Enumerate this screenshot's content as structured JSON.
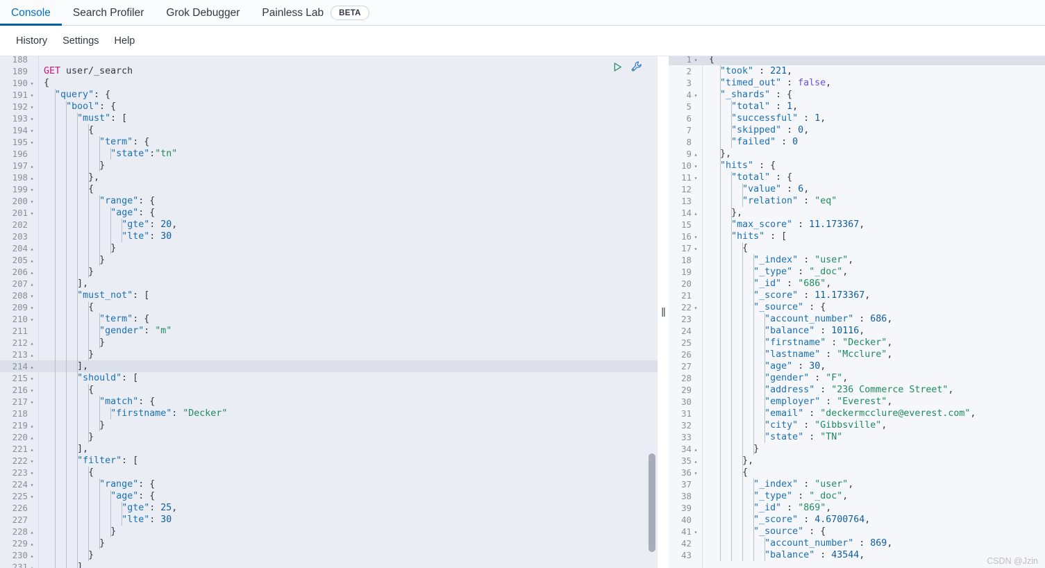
{
  "tabs": [
    {
      "label": "Console",
      "active": true,
      "badge": null
    },
    {
      "label": "Search Profiler",
      "active": false,
      "badge": null
    },
    {
      "label": "Grok Debugger",
      "active": false,
      "badge": null
    },
    {
      "label": "Painless Lab",
      "active": false,
      "badge": "BETA"
    }
  ],
  "subnav": [
    {
      "label": "History"
    },
    {
      "label": "Settings"
    },
    {
      "label": "Help"
    }
  ],
  "editor": {
    "actions": [
      {
        "name": "send-request-play-icon",
        "title": "Click to send request"
      },
      {
        "name": "wrench-icon",
        "title": "Open documentation"
      }
    ],
    "active_line": 214,
    "first_visible_line": 188,
    "lines": [
      {
        "n": 188,
        "fold": "",
        "text": "",
        "clipped": "top"
      },
      {
        "n": 189,
        "fold": "",
        "text": "GET user/_search"
      },
      {
        "n": 190,
        "fold": "v",
        "text": "{"
      },
      {
        "n": 191,
        "fold": "v",
        "text": "  \"query\": {"
      },
      {
        "n": 192,
        "fold": "v",
        "text": "    \"bool\": {"
      },
      {
        "n": 193,
        "fold": "v",
        "text": "      \"must\": ["
      },
      {
        "n": 194,
        "fold": "v",
        "text": "        {"
      },
      {
        "n": 195,
        "fold": "v",
        "text": "          \"term\": {"
      },
      {
        "n": 196,
        "fold": "",
        "text": "            \"state\":\"tn\""
      },
      {
        "n": 197,
        "fold": "^",
        "text": "          }"
      },
      {
        "n": 198,
        "fold": "^",
        "text": "        },"
      },
      {
        "n": 199,
        "fold": "v",
        "text": "        {"
      },
      {
        "n": 200,
        "fold": "v",
        "text": "          \"range\": {"
      },
      {
        "n": 201,
        "fold": "v",
        "text": "            \"age\": {"
      },
      {
        "n": 202,
        "fold": "",
        "text": "              \"gte\": 20,"
      },
      {
        "n": 203,
        "fold": "",
        "text": "              \"lte\": 30"
      },
      {
        "n": 204,
        "fold": "^",
        "text": "            }"
      },
      {
        "n": 205,
        "fold": "^",
        "text": "          }"
      },
      {
        "n": 206,
        "fold": "^",
        "text": "        }"
      },
      {
        "n": 207,
        "fold": "^",
        "text": "      ],"
      },
      {
        "n": 208,
        "fold": "v",
        "text": "      \"must_not\": ["
      },
      {
        "n": 209,
        "fold": "v",
        "text": "        {"
      },
      {
        "n": 210,
        "fold": "v",
        "text": "          \"term\": {"
      },
      {
        "n": 211,
        "fold": "",
        "text": "          \"gender\": \"m\""
      },
      {
        "n": 212,
        "fold": "^",
        "text": "          }"
      },
      {
        "n": 213,
        "fold": "^",
        "text": "        }"
      },
      {
        "n": 214,
        "fold": "^",
        "text": "      ],"
      },
      {
        "n": 215,
        "fold": "v",
        "text": "      \"should\": ["
      },
      {
        "n": 216,
        "fold": "v",
        "text": "        {"
      },
      {
        "n": 217,
        "fold": "v",
        "text": "          \"match\": {"
      },
      {
        "n": 218,
        "fold": "",
        "text": "            \"firstname\": \"Decker\""
      },
      {
        "n": 219,
        "fold": "^",
        "text": "          }"
      },
      {
        "n": 220,
        "fold": "^",
        "text": "        }"
      },
      {
        "n": 221,
        "fold": "^",
        "text": "      ],"
      },
      {
        "n": 222,
        "fold": "v",
        "text": "      \"filter\": ["
      },
      {
        "n": 223,
        "fold": "v",
        "text": "        {"
      },
      {
        "n": 224,
        "fold": "v",
        "text": "          \"range\": {"
      },
      {
        "n": 225,
        "fold": "v",
        "text": "            \"age\": {"
      },
      {
        "n": 226,
        "fold": "",
        "text": "              \"gte\": 25,"
      },
      {
        "n": 227,
        "fold": "",
        "text": "              \"lte\": 30"
      },
      {
        "n": 228,
        "fold": "^",
        "text": "            }"
      },
      {
        "n": 229,
        "fold": "^",
        "text": "          }"
      },
      {
        "n": 230,
        "fold": "^",
        "text": "        }"
      },
      {
        "n": 231,
        "fold": "^",
        "text": "      ]",
        "clipped": "bottom"
      }
    ]
  },
  "output": {
    "active_line": 1,
    "lines": [
      {
        "n": 1,
        "fold": "v",
        "text": "{"
      },
      {
        "n": 2,
        "fold": "",
        "text": "  \"took\" : 221,"
      },
      {
        "n": 3,
        "fold": "",
        "text": "  \"timed_out\" : false,"
      },
      {
        "n": 4,
        "fold": "v",
        "text": "  \"_shards\" : {"
      },
      {
        "n": 5,
        "fold": "",
        "text": "    \"total\" : 1,"
      },
      {
        "n": 6,
        "fold": "",
        "text": "    \"successful\" : 1,"
      },
      {
        "n": 7,
        "fold": "",
        "text": "    \"skipped\" : 0,"
      },
      {
        "n": 8,
        "fold": "",
        "text": "    \"failed\" : 0"
      },
      {
        "n": 9,
        "fold": "^",
        "text": "  },"
      },
      {
        "n": 10,
        "fold": "v",
        "text": "  \"hits\" : {"
      },
      {
        "n": 11,
        "fold": "v",
        "text": "    \"total\" : {"
      },
      {
        "n": 12,
        "fold": "",
        "text": "      \"value\" : 6,"
      },
      {
        "n": 13,
        "fold": "",
        "text": "      \"relation\" : \"eq\""
      },
      {
        "n": 14,
        "fold": "^",
        "text": "    },"
      },
      {
        "n": 15,
        "fold": "",
        "text": "    \"max_score\" : 11.173367,"
      },
      {
        "n": 16,
        "fold": "v",
        "text": "    \"hits\" : ["
      },
      {
        "n": 17,
        "fold": "v",
        "text": "      {"
      },
      {
        "n": 18,
        "fold": "",
        "text": "        \"_index\" : \"user\","
      },
      {
        "n": 19,
        "fold": "",
        "text": "        \"_type\" : \"_doc\","
      },
      {
        "n": 20,
        "fold": "",
        "text": "        \"_id\" : \"686\","
      },
      {
        "n": 21,
        "fold": "",
        "text": "        \"_score\" : 11.173367,"
      },
      {
        "n": 22,
        "fold": "v",
        "text": "        \"_source\" : {"
      },
      {
        "n": 23,
        "fold": "",
        "text": "          \"account_number\" : 686,"
      },
      {
        "n": 24,
        "fold": "",
        "text": "          \"balance\" : 10116,"
      },
      {
        "n": 25,
        "fold": "",
        "text": "          \"firstname\" : \"Decker\","
      },
      {
        "n": 26,
        "fold": "",
        "text": "          \"lastname\" : \"Mcclure\","
      },
      {
        "n": 27,
        "fold": "",
        "text": "          \"age\" : 30,"
      },
      {
        "n": 28,
        "fold": "",
        "text": "          \"gender\" : \"F\","
      },
      {
        "n": 29,
        "fold": "",
        "text": "          \"address\" : \"236 Commerce Street\","
      },
      {
        "n": 30,
        "fold": "",
        "text": "          \"employer\" : \"Everest\","
      },
      {
        "n": 31,
        "fold": "",
        "text": "          \"email\" : \"deckermcclure@everest.com\","
      },
      {
        "n": 32,
        "fold": "",
        "text": "          \"city\" : \"Gibbsville\","
      },
      {
        "n": 33,
        "fold": "",
        "text": "          \"state\" : \"TN\""
      },
      {
        "n": 34,
        "fold": "^",
        "text": "        }"
      },
      {
        "n": 35,
        "fold": "^",
        "text": "      },"
      },
      {
        "n": 36,
        "fold": "v",
        "text": "      {"
      },
      {
        "n": 37,
        "fold": "",
        "text": "        \"_index\" : \"user\","
      },
      {
        "n": 38,
        "fold": "",
        "text": "        \"_type\" : \"_doc\","
      },
      {
        "n": 39,
        "fold": "",
        "text": "        \"_id\" : \"869\","
      },
      {
        "n": 40,
        "fold": "",
        "text": "        \"_score\" : 4.6700764,"
      },
      {
        "n": 41,
        "fold": "v",
        "text": "        \"_source\" : {"
      },
      {
        "n": 42,
        "fold": "",
        "text": "          \"account_number\" : 869,"
      },
      {
        "n": 43,
        "fold": "",
        "text": "          \"balance\" : 43544,",
        "clipped": "bottom"
      }
    ]
  },
  "resizer": {
    "grip": "||"
  },
  "watermark": "CSDN @Jzin",
  "colors": {
    "accent": "#0061a6",
    "link": "#0071c2",
    "editor_bg": "#eaedf3",
    "output_bg": "#f5f7fa",
    "active_line": "#dce1e9",
    "key": "#1a70b3",
    "string": "#1e8a5e",
    "number": "#0b5d9e",
    "boolean": "#6c4de6",
    "method": "#c4147d",
    "play_icon": "#1f8a5f",
    "wrench_icon": "#2a7bbd"
  }
}
